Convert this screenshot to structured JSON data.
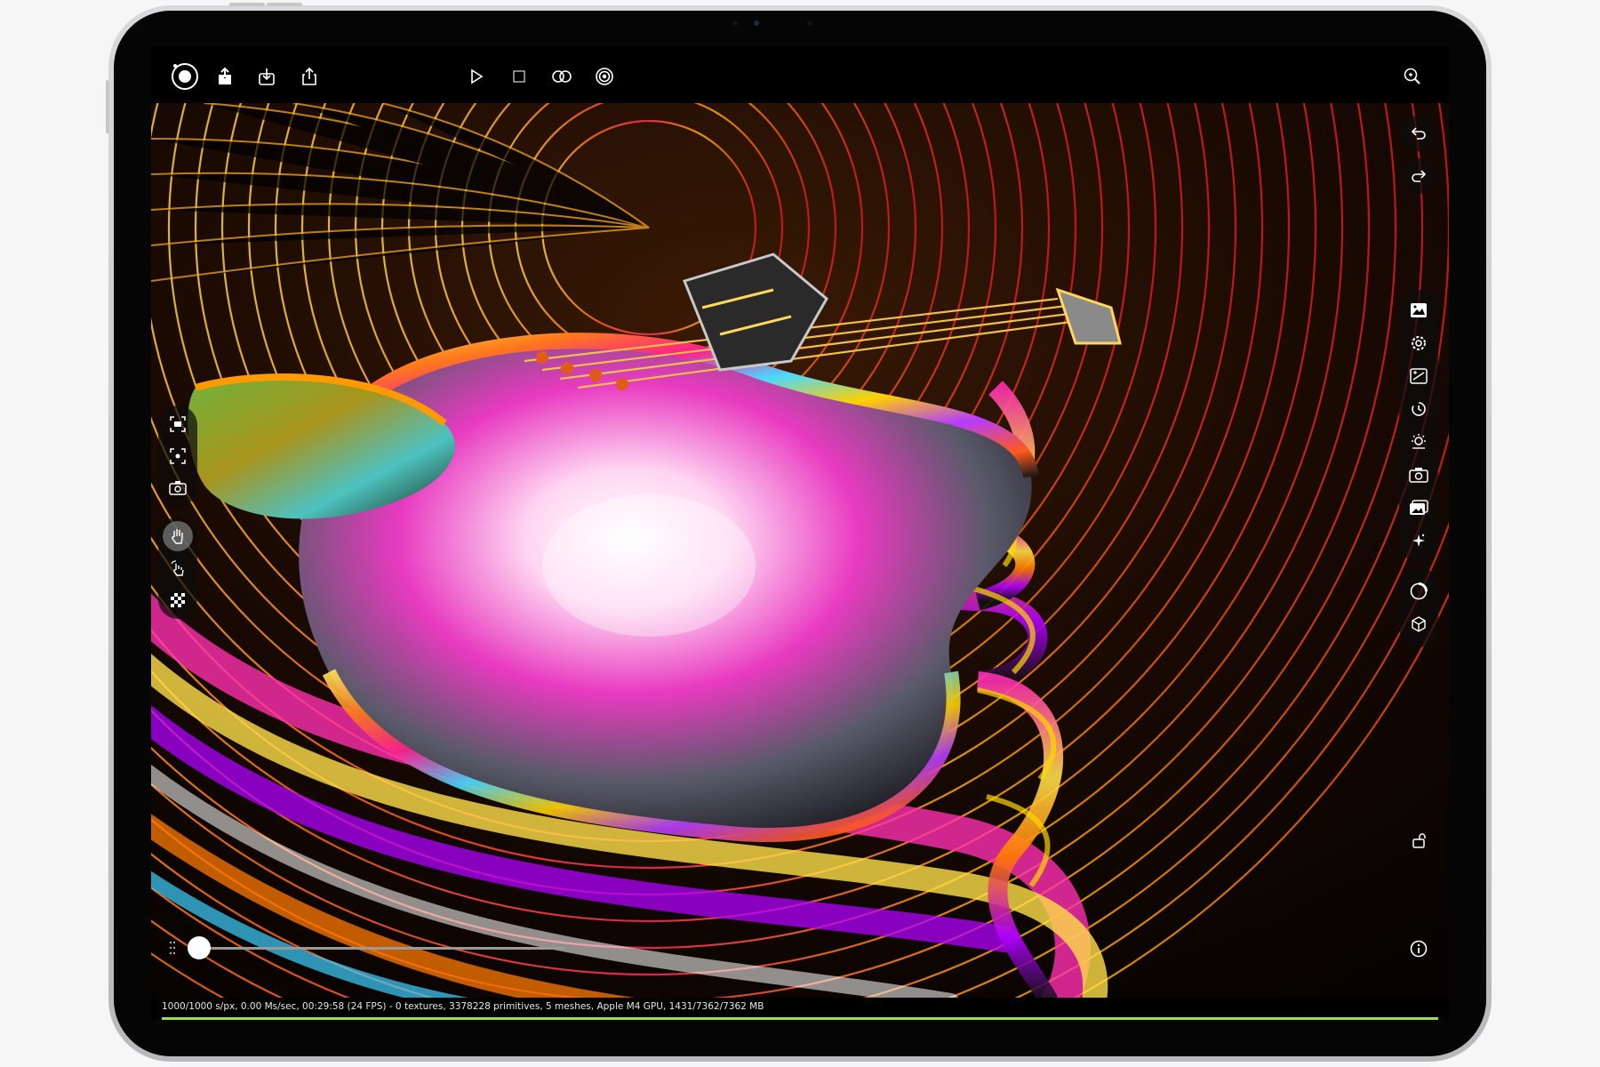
{
  "colors": {
    "accent_progress": "#8fe24f",
    "icon": "#ffffff",
    "screen_bg": "#000000"
  },
  "topbar": {
    "left_icons": [
      "render-logo-icon",
      "upload-icon",
      "import-icon",
      "share-icon"
    ],
    "center_icons": [
      "play-icon",
      "stop-icon",
      "toggle-icon",
      "target-icon"
    ],
    "right_icons": [
      "zoom-icon"
    ]
  },
  "left_toolbar": {
    "camera_tools": [
      "frame-camera-icon",
      "focus-icon",
      "camera-switch-icon"
    ],
    "interaction_tools": [
      "pan-hand-icon",
      "pick-hand-icon",
      "checkerboard-icon"
    ],
    "active_tool": "pan-hand-icon"
  },
  "right_toolbar": {
    "history": [
      "undo-icon",
      "redo-icon"
    ],
    "panels": [
      "image-icon",
      "settings-gear-icon",
      "imager-icon",
      "animation-icon",
      "environment-icon",
      "camera-icon",
      "film-icon",
      "sparkle-icon"
    ],
    "objects": [
      "material-icon",
      "geometry-cube-icon"
    ],
    "bottom": [
      "lock-icon",
      "info-icon"
    ]
  },
  "timeline": {
    "position": 0.0
  },
  "status": {
    "text": "1000/1000 s/px, 0.00 Ms/sec, 00:29:58 (24 FPS) - 0 textures, 3378228 primitives, 5 meshes, Apple M4 GPU, 1431/7362/7362 MB",
    "progress": 1.0
  }
}
